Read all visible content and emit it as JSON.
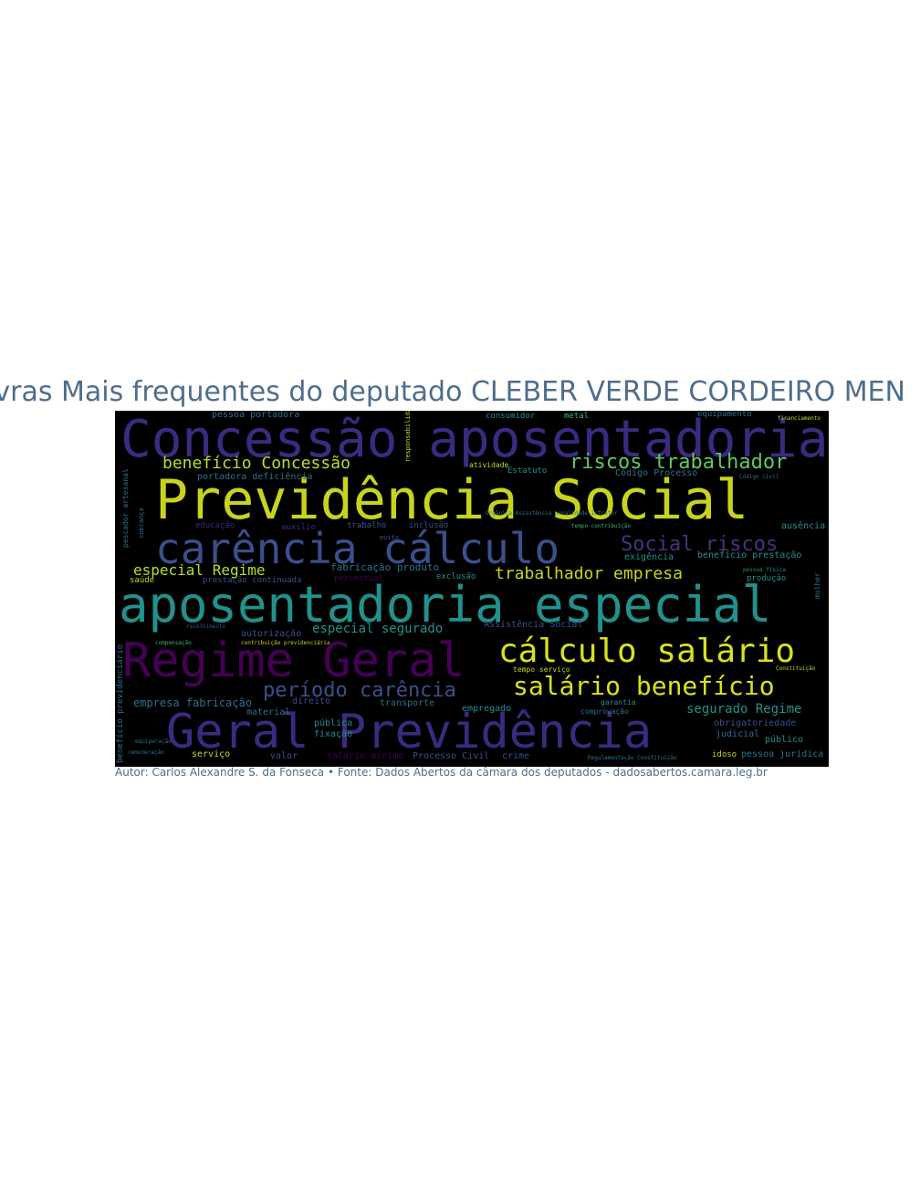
{
  "title": "avras Mais frequentes do deputado CLEBER VERDE CORDEIRO MEN",
  "caption": "Autor: Carlos Alexandre S. da Fonseca • Fonte: Dados Abertos da câmara dos deputados - dadosabertos.camara.leg.br",
  "colors": {
    "title": "#4f6d8c",
    "background": "#000000",
    "purple": "#440154",
    "indigo": "#3b2a80",
    "blue": "#3b4f8c",
    "teal": "#21918c",
    "green": "#35b779",
    "yellow": "#c8d41c"
  },
  "words": [
    {
      "text": "Concessão aposentadoria",
      "color": "#3b2a80",
      "size": 56
    },
    {
      "text": "Previdência Social",
      "color": "#c8d41c",
      "size": 60
    },
    {
      "text": "benefício Concessão",
      "color": "#b5de2b",
      "size": 18
    },
    {
      "text": "riscos trabalhador",
      "color": "#5ec962",
      "size": 22
    },
    {
      "text": "carência cálculo",
      "color": "#3b4f8c",
      "size": 46
    },
    {
      "text": "Social riscos",
      "color": "#46337e",
      "size": 22
    },
    {
      "text": "especial Regime",
      "color": "#b5de2b",
      "size": 16
    },
    {
      "text": "trabalhador empresa",
      "color": "#c8d41c",
      "size": 18
    },
    {
      "text": "aposentadoria especial",
      "color": "#21918c",
      "size": 54
    },
    {
      "text": "Regime Geral",
      "color": "#440154",
      "size": 52
    },
    {
      "text": "cálculo salário",
      "color": "#d8e219",
      "size": 36
    },
    {
      "text": "período carência",
      "color": "#3b4f8c",
      "size": 22
    },
    {
      "text": "salário benefício",
      "color": "#d8e219",
      "size": 28
    },
    {
      "text": "Geral Previdência",
      "color": "#3b2a80",
      "size": 52
    },
    {
      "text": "especial segurado",
      "color": "#21918c",
      "size": 14
    },
    {
      "text": "segurado Regime",
      "color": "#21918c",
      "size": 14
    },
    {
      "text": "empresa fabricação",
      "color": "#2c728e",
      "size": 12
    },
    {
      "text": "fabricação produto",
      "color": "#2c728e",
      "size": 11
    },
    {
      "text": "portadora deficiência",
      "color": "#2c728e",
      "size": 10
    },
    {
      "text": "pessoa portadora",
      "color": "#2c728e",
      "size": 10
    },
    {
      "text": "benefício prestação",
      "color": "#21918c",
      "size": 10
    },
    {
      "text": "exigência",
      "color": "#21918c",
      "size": 10
    },
    {
      "text": "Código Processo",
      "color": "#2c728e",
      "size": 10
    },
    {
      "text": "prestação continuada",
      "color": "#3b4f8c",
      "size": 9
    },
    {
      "text": "Assistência Social",
      "color": "#3b4f8c",
      "size": 10
    },
    {
      "text": "autorização",
      "color": "#3b4f8c",
      "size": 10
    },
    {
      "text": "transporte",
      "color": "#2c728e",
      "size": 10
    },
    {
      "text": "empregado",
      "color": "#21918c",
      "size": 10
    },
    {
      "text": "obrigatoriedade",
      "color": "#3b4f8c",
      "size": 10
    },
    {
      "text": "judicial",
      "color": "#2c728e",
      "size": 10
    },
    {
      "text": "público",
      "color": "#21918c",
      "size": 10
    },
    {
      "text": "pessoa jurídica",
      "color": "#2c728e",
      "size": 10
    },
    {
      "text": "idoso",
      "color": "#c8d41c",
      "size": 9
    },
    {
      "text": "Processo Civil",
      "color": "#3b4f8c",
      "size": 10
    },
    {
      "text": "crime",
      "color": "#3b4f8c",
      "size": 10
    },
    {
      "text": "salário mínimo",
      "color": "#440154",
      "size": 10
    },
    {
      "text": "valor",
      "color": "#3b4f8c",
      "size": 10
    },
    {
      "text": "serviço",
      "color": "#b5de2b",
      "size": 10
    },
    {
      "text": "pública",
      "color": "#21918c",
      "size": 10
    },
    {
      "text": "fixação",
      "color": "#21918c",
      "size": 10
    },
    {
      "text": "direito",
      "color": "#3b4f8c",
      "size": 10
    },
    {
      "text": "material",
      "color": "#2c728e",
      "size": 10
    },
    {
      "text": "percentual",
      "color": "#440154",
      "size": 9
    },
    {
      "text": "exclusão",
      "color": "#21918c",
      "size": 9
    },
    {
      "text": "auxílio",
      "color": "#3b2a80",
      "size": 9
    },
    {
      "text": "trabalho",
      "color": "#3b4f8c",
      "size": 9
    },
    {
      "text": "inclusão",
      "color": "#3b4f8c",
      "size": 9
    },
    {
      "text": "educação",
      "color": "#3b2a80",
      "size": 9
    },
    {
      "text": "saúde",
      "color": "#c8d41c",
      "size": 9
    },
    {
      "text": "ausência",
      "color": "#21918c",
      "size": 10
    },
    {
      "text": "produção",
      "color": "#21918c",
      "size": 9
    },
    {
      "text": "consumidor",
      "color": "#21918c",
      "size": 9
    },
    {
      "text": "metal",
      "color": "#35b779",
      "size": 9
    },
    {
      "text": "equipamento",
      "color": "#2c728e",
      "size": 9
    },
    {
      "text": "Estatuto",
      "color": "#21918c",
      "size": 9
    },
    {
      "text": "atividade",
      "color": "#b5de2b",
      "size": 8
    },
    {
      "text": "garantia",
      "color": "#21918c",
      "size": 8
    },
    {
      "text": "comprovação",
      "color": "#2c728e",
      "size": 8
    },
    {
      "text": "pescador artesanal",
      "color": "#2c728e",
      "size": 8
    },
    {
      "text": "tempo serviço",
      "color": "#2c728e",
      "size": 9
    },
    {
      "text": "benefício previdenciário",
      "color": "#2c728e",
      "size": 8
    },
    {
      "text": "mulher",
      "color": "#c8d41c",
      "size": 8
    },
    {
      "text": "muito",
      "color": "#3b4f8c",
      "size": 7
    },
    {
      "text": "responsabilidade",
      "color": "#35b779",
      "size": 6
    },
    {
      "text": "compensação",
      "color": "#c8d41c",
      "size": 6
    },
    {
      "text": "contribuição previdenciária",
      "color": "#2c728e",
      "size": 6
    },
    {
      "text": "Regulamentação Constituição",
      "color": "#2c728e",
      "size": 6
    },
    {
      "text": "Orgânica Assistência penalidade infrator",
      "color": "#35b779",
      "size": 6
    },
    {
      "text": "tempo contribuição",
      "color": "#21918c",
      "size": 6
    },
    {
      "text": "pessoa física",
      "color": "#2c728e",
      "size": 6
    },
    {
      "text": "Código Civil",
      "color": "#c8d41c",
      "size": 6
    },
    {
      "text": "Constituição",
      "color": "#b5de2b",
      "size": 6
    },
    {
      "text": "financiamento",
      "color": "#2c728e",
      "size": 7
    },
    {
      "text": "cobrança",
      "color": "#2c728e",
      "size": 6
    },
    {
      "text": "equiparação",
      "color": "#2c728e",
      "size": 6
    },
    {
      "text": "remuneração",
      "color": "#3b4f8c",
      "size": 6
    },
    {
      "text": "recolhimento",
      "color": "#3b4f8c",
      "size": 6
    }
  ]
}
